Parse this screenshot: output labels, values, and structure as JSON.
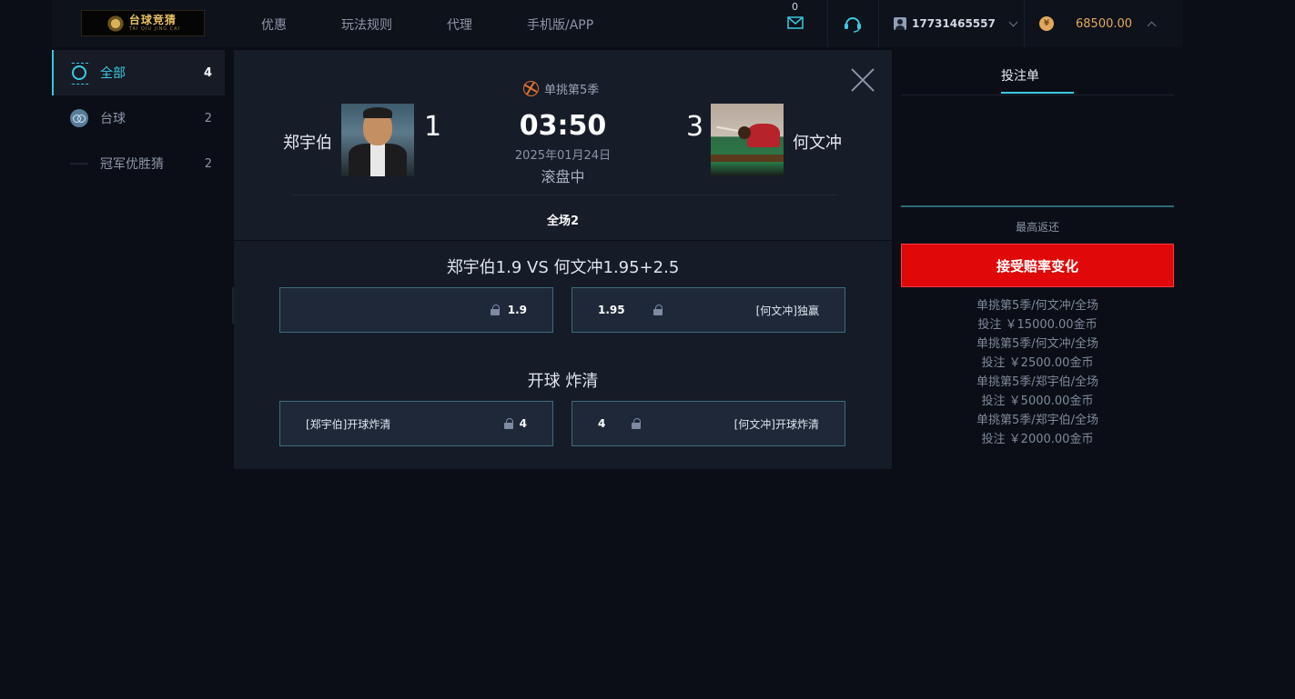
{
  "header": {
    "logo_text": "台球竞猜",
    "logo_sub": "TAI QIU JING CAI",
    "nav": [
      "优惠",
      "玩法规则",
      "代理",
      "手机版/APP"
    ],
    "mail_count": "0",
    "account": "17731465557",
    "balance": "68500.00",
    "accent": "#3cc9e0",
    "balance_color": "#e4a95c"
  },
  "sidebar": {
    "items": [
      {
        "label": "全部",
        "count": "4",
        "icon": "target-ring-icon"
      },
      {
        "label": "台球",
        "count": "2",
        "icon": "billiards-ball-icon"
      },
      {
        "label": "冠军优胜猜",
        "count": "2",
        "icon": "trophy-icon"
      }
    ]
  },
  "match": {
    "league": "单挑第5季",
    "home_name": "郑宇伯",
    "away_name": "何文冲",
    "home_score": "1",
    "away_score": "3",
    "clock": "03:50",
    "date": "2025年01月24日",
    "status": "滚盘中",
    "period_tab": "全场2"
  },
  "markets": [
    {
      "title": "郑宇伯1.9 VS 何文冲1.95+2.5",
      "left": {
        "label": "",
        "odds": "1.9"
      },
      "right": {
        "label": "[何文冲]独赢",
        "odds": "1.95"
      }
    },
    {
      "title": "开球 炸清",
      "left": {
        "label": "[郑宇伯]开球炸清",
        "odds": "4"
      },
      "right": {
        "label": "[何文冲]开球炸清",
        "odds": "4"
      }
    }
  ],
  "betslip": {
    "tab": "投注单",
    "max_return": "最高返还",
    "accept_button": "接受赔率变化",
    "accept_color": "#e00808",
    "history": [
      "单挑第5季/何文冲/全场",
      "投注 ￥15000.00金币",
      "单挑第5季/何文冲/全场",
      "投注 ￥2500.00金币",
      "单挑第5季/郑宇伯/全场",
      "投注 ￥5000.00金币",
      "单挑第5季/郑宇伯/全场",
      "投注 ￥2000.00金币"
    ]
  }
}
